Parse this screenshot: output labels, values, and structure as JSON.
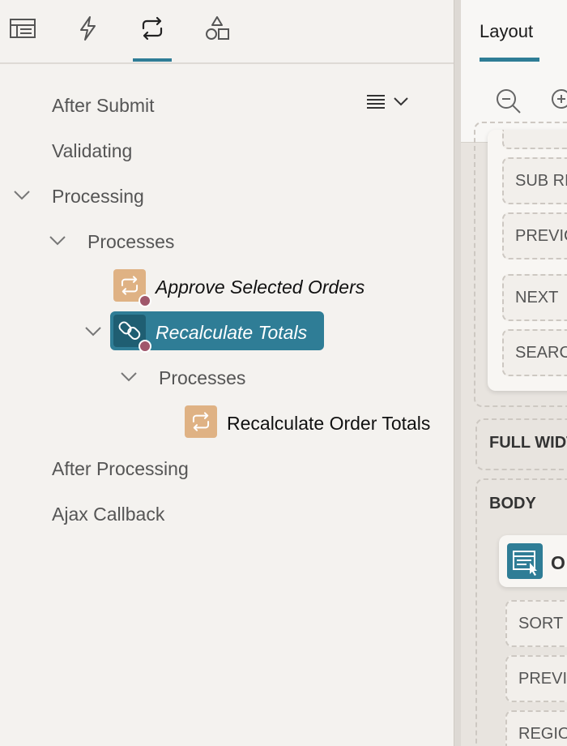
{
  "tabs": [
    {
      "icon": "rendering-table-icon",
      "active": false
    },
    {
      "icon": "lightning-icon",
      "active": false
    },
    {
      "icon": "processing-loop-icon",
      "active": true
    },
    {
      "icon": "shapes-icon",
      "active": false
    }
  ],
  "tree": {
    "after_submit": "After Submit",
    "validating": "Validating",
    "processing": "Processing",
    "processes": "Processes",
    "approve_selected_orders": "Approve Selected Orders",
    "recalculate_totals": "Recalculate Totals",
    "child_processes": "Processes",
    "recalculate_order_totals": "Recalculate Order Totals",
    "after_processing": "After Processing",
    "ajax_callback": "Ajax Callback"
  },
  "right": {
    "tab_layout": "Layout",
    "slots": {
      "sub_regions": "SUB RE",
      "previous": "PREVIC",
      "next": "NEXT",
      "search": "SEARC",
      "full_width": "FULL WIDT",
      "body": "BODY",
      "orders_title": "O",
      "sort": "SORT (",
      "previous2": "PREVIC",
      "region": "REGIO"
    }
  },
  "colors": {
    "accent": "#2f7d96",
    "process_icon_bg": "#dfb284",
    "badge": "#a0576b"
  }
}
